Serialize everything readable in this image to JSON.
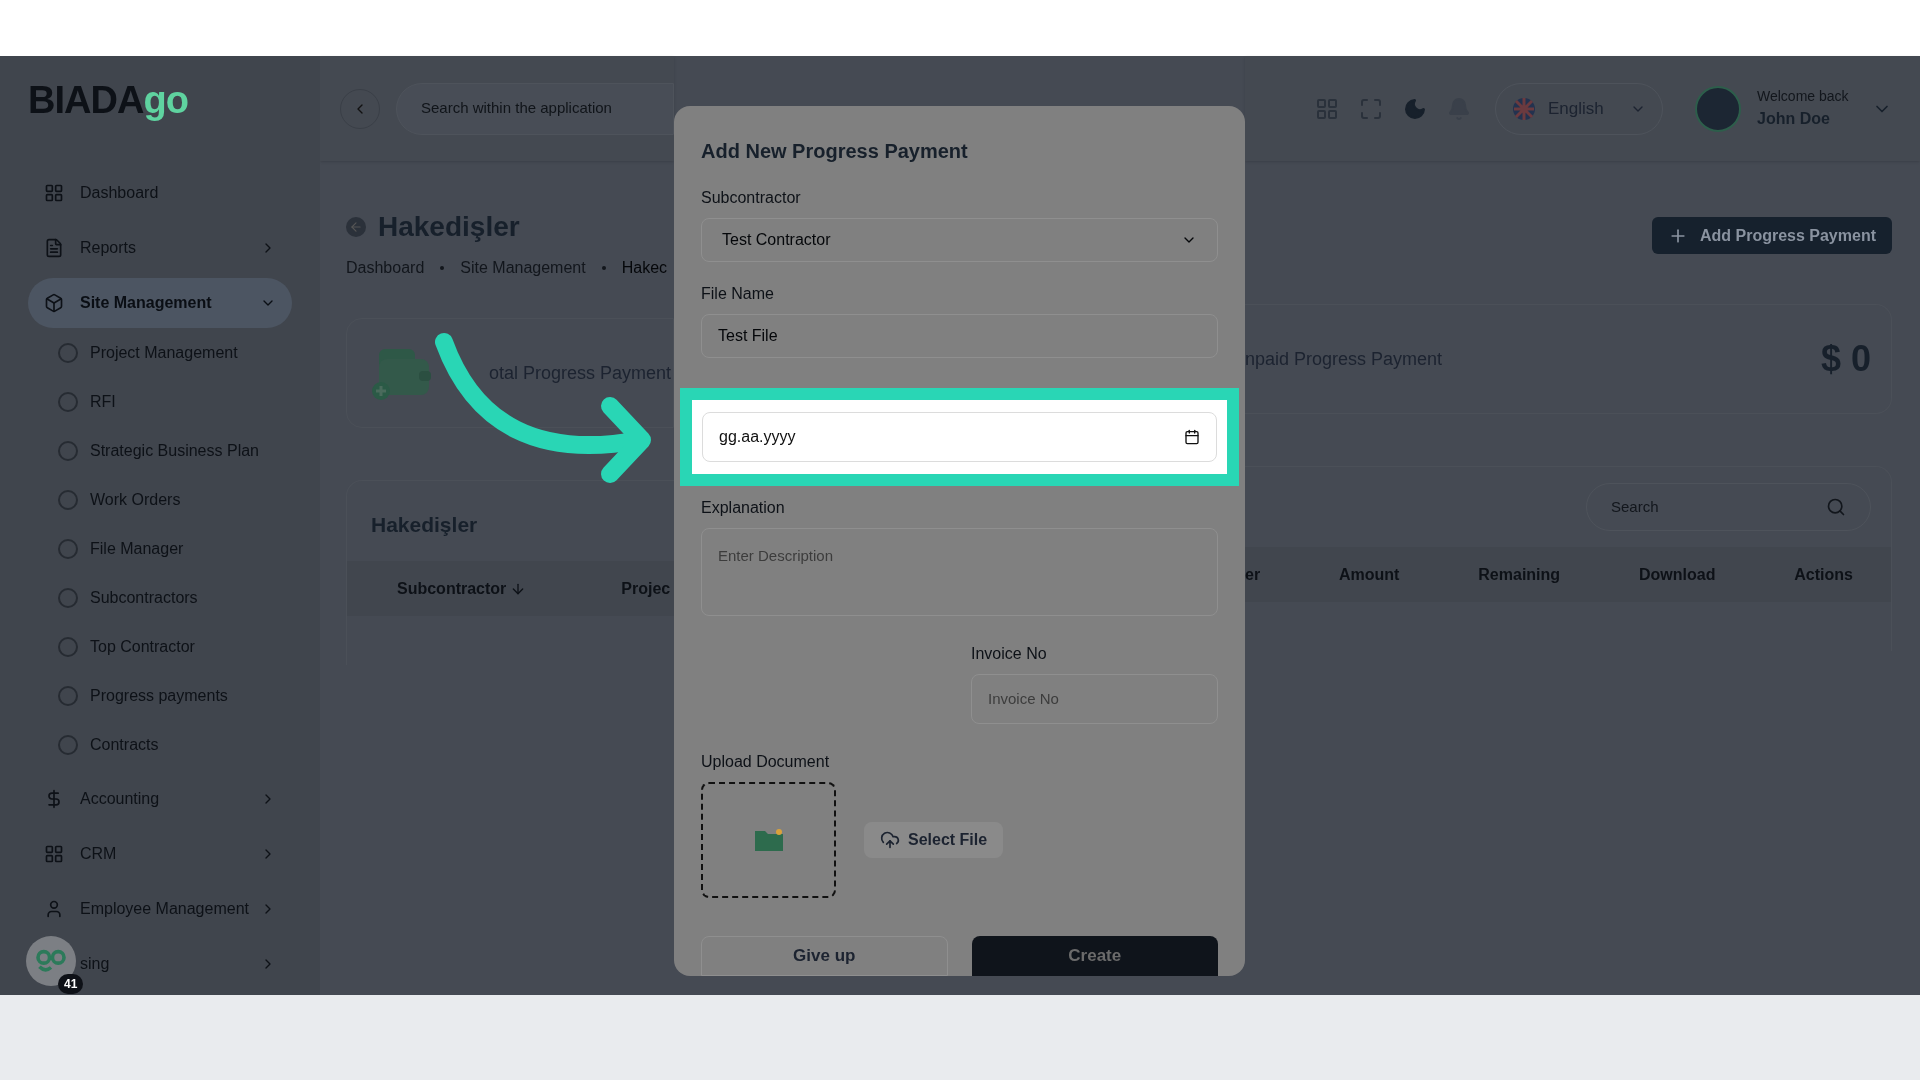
{
  "header": {
    "logo": {
      "dark": "BIADA",
      "accent": "go"
    },
    "search": {
      "placeholder": "Search within the application"
    },
    "language": "English",
    "user": {
      "greeting": "Welcome back",
      "name": "John Doe"
    }
  },
  "sidebar": {
    "items": [
      {
        "label": "Dashboard",
        "selected": false
      },
      {
        "label": "Reports",
        "selected": false,
        "expanded": false
      },
      {
        "label": "Site Management",
        "selected": true,
        "expanded": true,
        "children": [
          {
            "label": "Project Management"
          },
          {
            "label": "RFI"
          },
          {
            "label": "Strategic Business Plan"
          },
          {
            "label": "Work Orders"
          },
          {
            "label": "File Manager"
          },
          {
            "label": "Subcontractors"
          },
          {
            "label": "Top Contractor"
          },
          {
            "label": "Progress payments"
          },
          {
            "label": "Contracts"
          }
        ]
      },
      {
        "label": "Accounting",
        "selected": false,
        "expanded": false
      },
      {
        "label": "CRM",
        "selected": false,
        "expanded": false
      },
      {
        "label": "Employee Management",
        "selected": false,
        "expanded": false
      },
      {
        "label": "sing",
        "selected": false,
        "expanded": false
      }
    ]
  },
  "help_bubble": {
    "count": "41"
  },
  "page": {
    "title": "Hakedişler",
    "breadcrumb": [
      "Dashboard",
      "Site Management",
      "Hakec"
    ],
    "add_button": "Add Progress Payment"
  },
  "summary_cards": [
    {
      "label": "otal Progress Payment"
    },
    {
      "label": "npaid Progress Payment",
      "value": "$ 0"
    }
  ],
  "table": {
    "title": "Hakedişler",
    "search": {
      "placeholder": "Search"
    },
    "columns": [
      {
        "label": "Subcontractor",
        "sorted": true
      },
      {
        "label": "Projec",
        "sorted": false
      },
      {
        "label": "er",
        "sorted": false
      },
      {
        "label": "Amount",
        "sorted": false
      },
      {
        "label": "Remaining",
        "sorted": false
      },
      {
        "label": "Download",
        "sorted": false
      },
      {
        "label": "Actions",
        "sorted": false
      }
    ]
  },
  "dialog": {
    "title": "Add New Progress Payment",
    "subcontractor": {
      "label": "Subcontractor",
      "value": "Test Contractor"
    },
    "file_name": {
      "label": "File Name",
      "value": "Test File"
    },
    "date": {
      "value": "gg.aa.yyyy"
    },
    "explanation": {
      "label": "Explanation",
      "placeholder": "Enter Description"
    },
    "invoice": {
      "label": "Invoice No",
      "placeholder": "Invoice No"
    },
    "upload": {
      "label": "Upload Document",
      "button": "Select File"
    },
    "buttons": [
      "Give up",
      "Create"
    ]
  }
}
